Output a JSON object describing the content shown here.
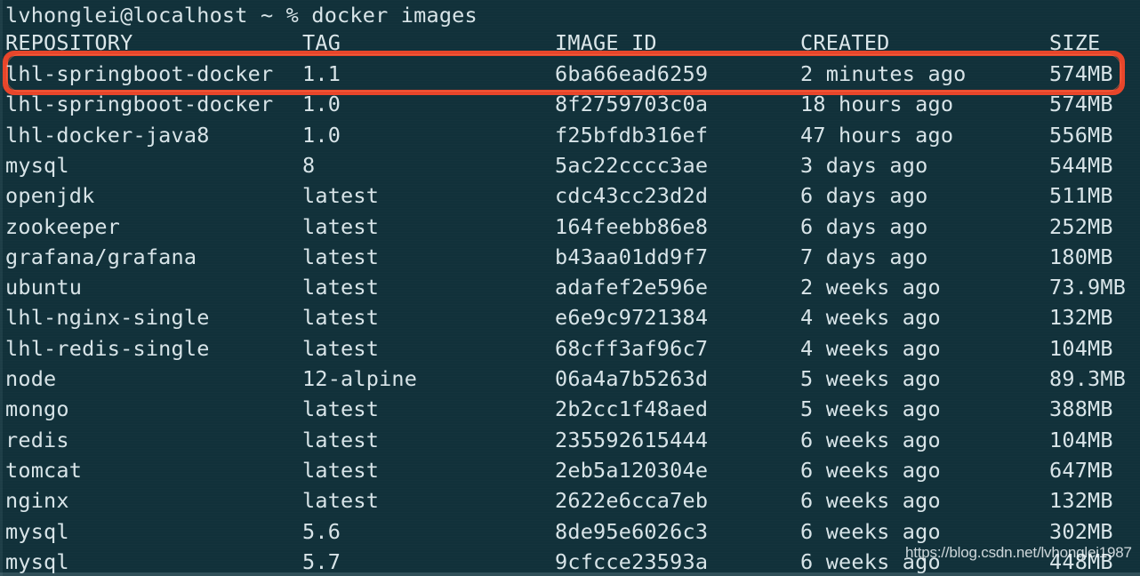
{
  "terminal": {
    "prompt_line": "lvhonglei@localhost ~ % docker images",
    "background_color": "#11313a",
    "text_color": "#d8e4e8",
    "user": "lvhonglei",
    "host": "localhost",
    "path": "~",
    "prompt_symbol": "%",
    "command": "docker images"
  },
  "table": {
    "headers": {
      "repository": "REPOSITORY",
      "tag": "TAG",
      "image_id": "IMAGE ID",
      "created": "CREATED",
      "size": "SIZE"
    },
    "rows": [
      {
        "repository": "lhl-springboot-docker",
        "tag": "1.1",
        "image_id": "6ba66ead6259",
        "created": "2 minutes ago",
        "size": "574MB"
      },
      {
        "repository": "lhl-springboot-docker",
        "tag": "1.0",
        "image_id": "8f2759703c0a",
        "created": "18 hours ago",
        "size": "574MB"
      },
      {
        "repository": "lhl-docker-java8",
        "tag": "1.0",
        "image_id": "f25bfdb316ef",
        "created": "47 hours ago",
        "size": "556MB"
      },
      {
        "repository": "mysql",
        "tag": "8",
        "image_id": "5ac22cccc3ae",
        "created": "3 days ago",
        "size": "544MB"
      },
      {
        "repository": "openjdk",
        "tag": "latest",
        "image_id": "cdc43cc23d2d",
        "created": "6 days ago",
        "size": "511MB"
      },
      {
        "repository": "zookeeper",
        "tag": "latest",
        "image_id": "164feebb86e8",
        "created": "6 days ago",
        "size": "252MB"
      },
      {
        "repository": "grafana/grafana",
        "tag": "latest",
        "image_id": "b43aa01dd9f7",
        "created": "7 days ago",
        "size": "180MB"
      },
      {
        "repository": "ubuntu",
        "tag": "latest",
        "image_id": "adafef2e596e",
        "created": "2 weeks ago",
        "size": "73.9MB"
      },
      {
        "repository": "lhl-nginx-single",
        "tag": "latest",
        "image_id": "e6e9c9721384",
        "created": "4 weeks ago",
        "size": "132MB"
      },
      {
        "repository": "lhl-redis-single",
        "tag": "latest",
        "image_id": "68cff3af96c7",
        "created": "4 weeks ago",
        "size": "104MB"
      },
      {
        "repository": "node",
        "tag": "12-alpine",
        "image_id": "06a4a7b5263d",
        "created": "5 weeks ago",
        "size": "89.3MB"
      },
      {
        "repository": "mongo",
        "tag": "latest",
        "image_id": "2b2cc1f48aed",
        "created": "5 weeks ago",
        "size": "388MB"
      },
      {
        "repository": "redis",
        "tag": "latest",
        "image_id": "235592615444",
        "created": "6 weeks ago",
        "size": "104MB"
      },
      {
        "repository": "tomcat",
        "tag": "latest",
        "image_id": "2eb5a120304e",
        "created": "6 weeks ago",
        "size": "647MB"
      },
      {
        "repository": "nginx",
        "tag": "latest",
        "image_id": "2622e6cca7eb",
        "created": "6 weeks ago",
        "size": "132MB"
      },
      {
        "repository": "mysql",
        "tag": "5.6",
        "image_id": "8de95e6026c3",
        "created": "6 weeks ago",
        "size": "302MB"
      },
      {
        "repository": "mysql",
        "tag": "5.7",
        "image_id": "9cfcce23593a",
        "created": "6 weeks ago",
        "size": "448MB"
      }
    ],
    "highlighted_row_index": 0
  },
  "annotation": {
    "type": "rectangle",
    "color": "#e8452a",
    "target_row": "lhl-springboot-docker 1.1"
  },
  "watermark": {
    "text": "https://blog.csdn.net/lvhonglei1987"
  }
}
